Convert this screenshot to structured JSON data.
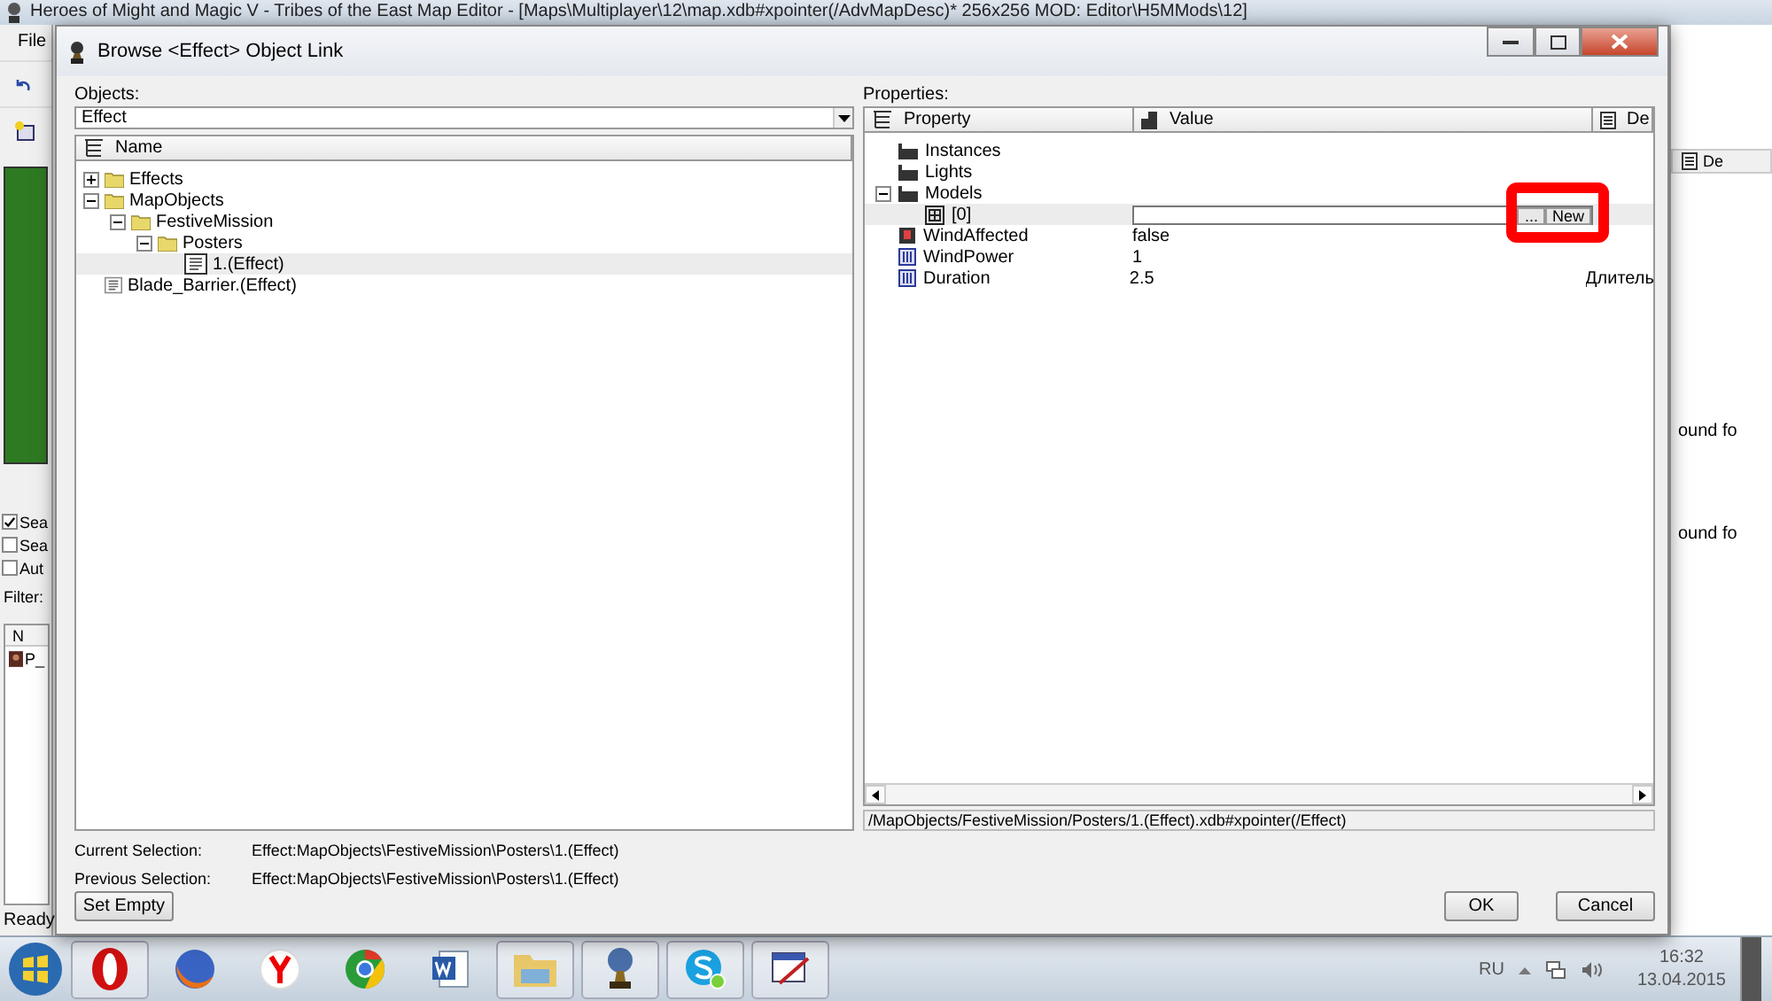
{
  "background_app": {
    "title": "Heroes of Might and Magic V - Tribes of the East Map Editor - [Maps\\Multiplayer\\12\\map.xdb#xpointer(/AdvMapDesc)* 256x256 MOD: Editor\\H5MMods\\12]",
    "menu": [
      "File"
    ],
    "options": [
      {
        "label": "Sea",
        "checked": true
      },
      {
        "label": "Sea",
        "checked": false
      },
      {
        "label": "Aut",
        "checked": false
      }
    ],
    "filter_label": "Filter:",
    "list_header": "N",
    "list_item": "P_",
    "status": "Ready",
    "right_header": "De",
    "right_cells": [
      "ound fo",
      "ound fo"
    ]
  },
  "dialog": {
    "title": "Browse <Effect> Object Link",
    "objects_label": "Objects:",
    "type_combo": "Effect",
    "tree_column": "Name",
    "tree": [
      {
        "label": "Effects",
        "kind": "folder",
        "expanded": false,
        "selected": false
      },
      {
        "label": "MapObjects",
        "kind": "folder",
        "expanded": true,
        "selected": false,
        "children": [
          {
            "label": "FestiveMission",
            "kind": "folder",
            "expanded": true,
            "selected": false,
            "children": [
              {
                "label": "Posters",
                "kind": "folder",
                "expanded": true,
                "selected": false,
                "children": [
                  {
                    "label": "1.(Effect)",
                    "kind": "file",
                    "selected": true
                  }
                ]
              }
            ]
          }
        ]
      },
      {
        "label": "Blade_Barrier.(Effect)",
        "kind": "file",
        "selected": false
      }
    ],
    "properties_label": "Properties:",
    "columns": [
      "Property",
      "Value",
      "De"
    ],
    "properties": [
      {
        "name": "Instances",
        "kind": "folder",
        "selected": false
      },
      {
        "name": "Lights",
        "kind": "folder",
        "selected": false
      },
      {
        "name": "Models",
        "kind": "folder",
        "expanded": true,
        "selected": false,
        "children": [
          {
            "name": "[0]",
            "kind": "link",
            "selected": true,
            "browse_button": "...",
            "new_button": "New"
          }
        ]
      },
      {
        "name": "WindAffected",
        "kind": "bool",
        "value": "false",
        "selected": false
      },
      {
        "name": "WindPower",
        "kind": "number",
        "value": "1",
        "selected": false
      },
      {
        "name": "Duration",
        "kind": "number",
        "value": "2.5",
        "description": "Длитель",
        "selected": false
      }
    ],
    "path": "/MapObjects/FestiveMission/Posters/1.(Effect).xdb#xpointer(/Effect)",
    "current_selection_label": "Current Selection:",
    "current_selection": "Effect:MapObjects\\FestiveMission\\Posters\\1.(Effect)",
    "previous_selection_label": "Previous Selection:",
    "previous_selection": "Effect:MapObjects\\FestiveMission\\Posters\\1.(Effect)",
    "set_empty_button": "Set Empty",
    "ok_button": "OK",
    "cancel_button": "Cancel"
  },
  "taskbar": {
    "apps": [
      {
        "kind": "opera"
      },
      {
        "kind": "firefox"
      },
      {
        "kind": "yandex"
      },
      {
        "kind": "chrome"
      },
      {
        "kind": "word"
      },
      {
        "kind": "explorer"
      },
      {
        "kind": "game"
      },
      {
        "kind": "skype"
      },
      {
        "kind": "editor"
      }
    ],
    "language": "RU",
    "time": "16:32",
    "date": "13.04.2015"
  }
}
